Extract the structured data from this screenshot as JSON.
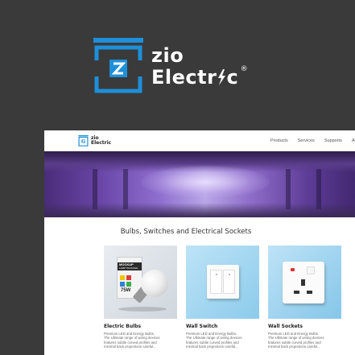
{
  "brand": {
    "line1": "zio",
    "line2": "Electr",
    "line2_tail": "c",
    "registered": "®",
    "colors": {
      "logo_blue": "#1e8fd9",
      "background": "#3a3a3a"
    }
  },
  "website": {
    "nav": {
      "logo_line1": "zio",
      "logo_line2": "Electric",
      "links": [
        "Products",
        "Services",
        "Supports",
        "Ab"
      ]
    },
    "hero": {
      "description": ""
    },
    "section_title": "Bulbs, Switches and Electrical Sockets",
    "products": [
      {
        "title": "Electric Bulbs",
        "desc": [
          "Premium LED and Energy Bulbs.",
          "The Ultimate range of wiring devices",
          "features subtle curved profiles and",
          "minimal back projections careful..."
        ],
        "package": {
          "line1": "MOCKUP",
          "line2": "LAMP PACKAGE",
          "watt": "75W"
        }
      },
      {
        "title": "Wall Switch",
        "desc": [
          "Premium LED and Energy Bulbs.",
          "The Ultimate range of wiring devices",
          "features subtle curved profiles and",
          "minimal back projections careful..."
        ]
      },
      {
        "title": "Wall Sockets",
        "desc": [
          "Premium LED and Energy Bulbs.",
          "The Ultimate range of wiring devices",
          "features subtle curved profiles and",
          "minimal back projections careful..."
        ]
      }
    ]
  }
}
